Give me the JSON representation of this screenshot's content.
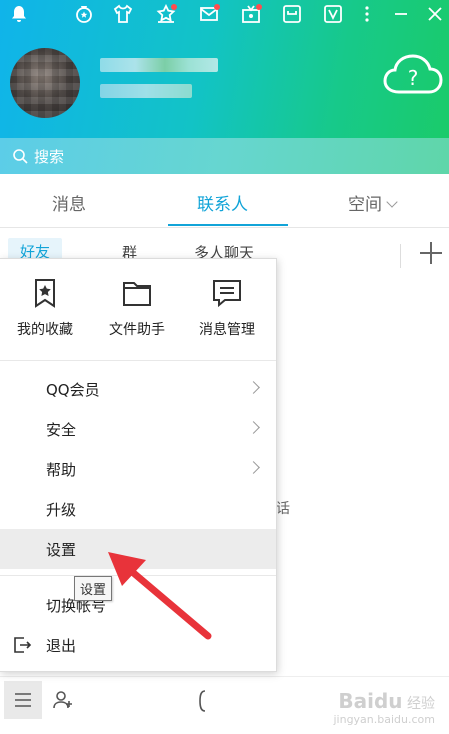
{
  "search": {
    "placeholder": "搜索"
  },
  "tabs": [
    {
      "label": "消息"
    },
    {
      "label": "联系人"
    },
    {
      "label": "空间"
    }
  ],
  "subtabs": [
    {
      "label": "好友"
    },
    {
      "label": "群"
    },
    {
      "label": "多人聊天"
    }
  ],
  "background_text": "话",
  "quick_actions": [
    {
      "label": "我的收藏",
      "icon": "bookmark-star-icon"
    },
    {
      "label": "文件助手",
      "icon": "folder-icon"
    },
    {
      "label": "消息管理",
      "icon": "message-icon"
    }
  ],
  "menu": {
    "items": [
      {
        "label": "QQ会员",
        "has_submenu": true
      },
      {
        "label": "安全",
        "has_submenu": true
      },
      {
        "label": "帮助",
        "has_submenu": true
      },
      {
        "label": "升级",
        "has_submenu": false
      },
      {
        "label": "设置",
        "has_submenu": false,
        "highlighted": true
      },
      {
        "label": "切换帐号",
        "has_submenu": false
      },
      {
        "label": "退出",
        "has_submenu": false
      }
    ]
  },
  "tooltip": "设置",
  "watermark": {
    "brand": "Bai",
    "paw": "du",
    "suffix": "经验",
    "url": "jingyan.baidu.com"
  },
  "colors": {
    "accent": "#12a4d8",
    "header_start": "#10b4ea",
    "header_end": "#1acb6a",
    "arrow": "#e8333a"
  }
}
